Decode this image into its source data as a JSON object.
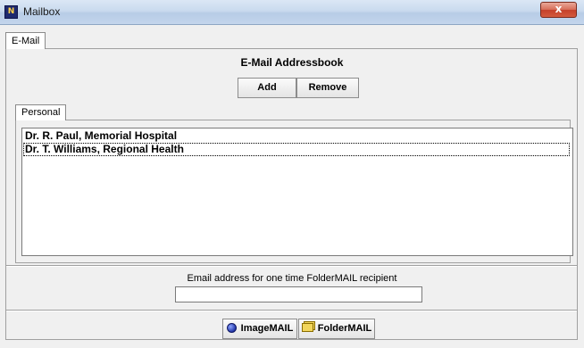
{
  "window": {
    "title": "Mailbox",
    "app_icon_glyph": "N",
    "close_glyph": "x"
  },
  "tabs": {
    "outer": "E-Mail",
    "inner": "Personal"
  },
  "addressbook": {
    "heading": "E-Mail Addressbook",
    "add_label": "Add",
    "remove_label": "Remove",
    "entries": [
      "Dr. R. Paul, Memorial Hospital",
      "Dr. T. Williams, Regional Health"
    ],
    "focused_entry_index": 1
  },
  "recipient": {
    "label": "Email address for one time FolderMAIL recipient",
    "value": ""
  },
  "actions": {
    "imagemail_label": "ImageMAIL",
    "foldermail_label": "FolderMAIL"
  },
  "icons": {
    "app": "app-logo-icon",
    "close": "close-icon",
    "imagemail": "globe-icon",
    "foldermail": "folder-icon"
  }
}
